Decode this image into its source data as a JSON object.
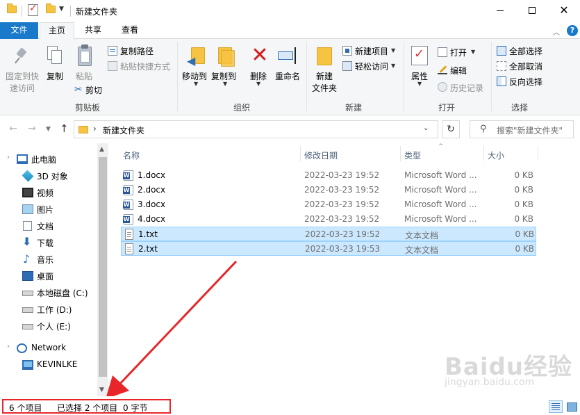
{
  "window": {
    "title": "新建文件夹",
    "min_glyph": "",
    "close_glyph": "✕"
  },
  "tabs": {
    "file": "文件",
    "home": "主页",
    "share": "共享",
    "view": "查看"
  },
  "ribbon": {
    "clipboard": {
      "group_label": "剪贴板",
      "pin_label_1": "固定到快",
      "pin_label_2": "速访问",
      "copy": "复制",
      "paste": "粘贴",
      "copy_path": "复制路径",
      "paste_shortcut": "粘贴快捷方式",
      "cut": "剪切"
    },
    "organize": {
      "group_label": "组织",
      "move_to": "移动到",
      "copy_to": "复制到",
      "delete": "删除",
      "rename": "重命名"
    },
    "new": {
      "group_label": "新建",
      "new_folder_1": "新建",
      "new_folder_2": "文件夹",
      "new_item": "新建项目",
      "easy_access": "轻松访问"
    },
    "open": {
      "group_label": "打开",
      "properties": "属性",
      "open": "打开",
      "edit": "编辑",
      "history": "历史记录"
    },
    "select": {
      "group_label": "选择",
      "select_all": "全部选择",
      "select_none": "全部取消",
      "invert": "反向选择"
    }
  },
  "address": {
    "path": "新建文件夹",
    "search_placeholder": "搜索\"新建文件夹\""
  },
  "nav": {
    "items": [
      {
        "label": "此电脑",
        "icon": "computer-icon"
      },
      {
        "label": "3D 对象",
        "icon": "3d-objects-icon"
      },
      {
        "label": "视频",
        "icon": "video-icon"
      },
      {
        "label": "图片",
        "icon": "pictures-icon"
      },
      {
        "label": "文档",
        "icon": "documents-icon"
      },
      {
        "label": "下载",
        "icon": "download-icon"
      },
      {
        "label": "音乐",
        "icon": "music-icon"
      },
      {
        "label": "桌面",
        "icon": "desktop-icon"
      },
      {
        "label": "本地磁盘 (C:)",
        "icon": "drive-icon"
      },
      {
        "label": "工作 (D:)",
        "icon": "drive-icon"
      },
      {
        "label": "个人 (E:)",
        "icon": "drive-icon"
      },
      {
        "label": "Network",
        "icon": "network-icon"
      },
      {
        "label": "KEVINLKE",
        "icon": "computer-icon"
      }
    ]
  },
  "filelist": {
    "columns": {
      "name": "名称",
      "date": "修改日期",
      "type": "类型",
      "size": "大小"
    },
    "rows": [
      {
        "name": "1.docx",
        "date": "2022-03-23 19:52",
        "type": "Microsoft Word ...",
        "size": "0 KB",
        "icon": "word-icon",
        "selected": false
      },
      {
        "name": "2.docx",
        "date": "2022-03-23 19:52",
        "type": "Microsoft Word ...",
        "size": "0 KB",
        "icon": "word-icon",
        "selected": false
      },
      {
        "name": "3.docx",
        "date": "2022-03-23 19:52",
        "type": "Microsoft Word ...",
        "size": "0 KB",
        "icon": "word-icon",
        "selected": false
      },
      {
        "name": "4.docx",
        "date": "2022-03-23 19:52",
        "type": "Microsoft Word ...",
        "size": "0 KB",
        "icon": "word-icon",
        "selected": false
      },
      {
        "name": "1.txt",
        "date": "2022-03-23 19:52",
        "type": "文本文档",
        "size": "0 KB",
        "icon": "text-file-icon",
        "selected": true
      },
      {
        "name": "2.txt",
        "date": "2022-03-23 19:53",
        "type": "文本文档",
        "size": "0 KB",
        "icon": "text-file-icon",
        "selected": true
      }
    ]
  },
  "status": {
    "item_count": "6 个项目",
    "selected": "已选择 2 个项目",
    "size": "0 字节"
  },
  "watermark": {
    "brand": "Baidu经验",
    "sub": "jingyan.baidu.com"
  },
  "colors": {
    "accent": "#1979ca",
    "selection": "#cce8ff",
    "annotation": "#e8262a"
  }
}
